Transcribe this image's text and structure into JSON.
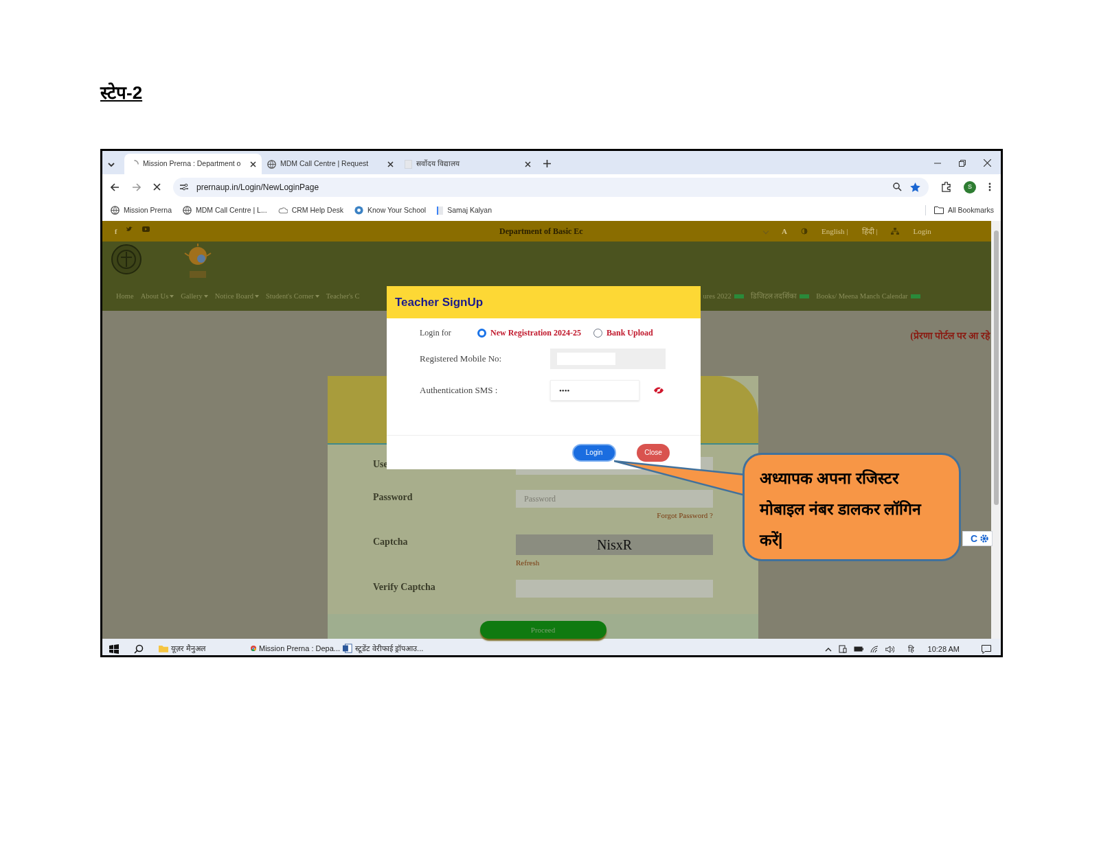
{
  "heading": "स्टेप-2",
  "browser": {
    "tabs": [
      {
        "title": "Mission Prerna : Department o",
        "selected": true,
        "kind": "loading"
      },
      {
        "title": "MDM Call Centre | Request",
        "selected": false,
        "kind": "globe"
      },
      {
        "title": "सर्वोदय विद्यालय",
        "selected": false,
        "kind": "blank"
      }
    ],
    "url": "prernaup.in/Login/NewLoginPage",
    "profile": "S",
    "bookmarks": [
      {
        "label": "Mission Prerna",
        "kind": "globe"
      },
      {
        "label": "MDM Call Centre | L...",
        "kind": "globe"
      },
      {
        "label": "CRM Help Desk",
        "kind": "cloud"
      },
      {
        "label": "Know Your School",
        "kind": "badge"
      },
      {
        "label": "Samaj Kalyan",
        "kind": "blank"
      }
    ],
    "all_bookmarks": "All Bookmarks"
  },
  "site": {
    "top_bar": {
      "facebook": "f",
      "font_size": "A",
      "title": "Department of Basic Ec",
      "links": [
        "English |",
        "हिंदी |",
        "Login"
      ]
    },
    "nav": [
      {
        "label": "Home",
        "dropdown": false,
        "new": false
      },
      {
        "label": "About Us",
        "dropdown": true,
        "new": false
      },
      {
        "label": "Gallery",
        "dropdown": true,
        "new": false
      },
      {
        "label": "Notice Board",
        "dropdown": true,
        "new": false
      },
      {
        "label": "Student's Corner",
        "dropdown": true,
        "new": false
      },
      {
        "label": "Teacher's C",
        "dropdown": false,
        "new": false
      },
      {
        "label": "ures 2022",
        "dropdown": false,
        "new": true
      },
      {
        "label": "डिजिटल तदर्शिका",
        "dropdown": false,
        "new": true
      },
      {
        "label": "Books/ Meena Manch Calendar",
        "dropdown": false,
        "new": true
      }
    ],
    "notice": "(प्रेरणा पोर्टल पर आ रहे",
    "form": {
      "fields": [
        {
          "label": "Use",
          "kind": "text"
        },
        {
          "label": "Password",
          "kind": "text",
          "placeholder": "Password",
          "link": "Forgot Password ?"
        },
        {
          "label": "Captcha",
          "kind": "captcha",
          "captcha": "NisxR",
          "link": "Refresh"
        },
        {
          "label": "Verify Captcha",
          "kind": "text"
        }
      ],
      "button": "Proceed"
    },
    "widget": "C"
  },
  "modal": {
    "title": "Teacher SignUp",
    "login_for": "Login for",
    "options": [
      {
        "label": "New Registration 2024-25",
        "selected": true
      },
      {
        "label": "Bank Upload",
        "selected": false
      }
    ],
    "fields": [
      {
        "label": "Registered Mobile No:",
        "kind": "text"
      },
      {
        "label": "Authentication SMS :",
        "kind": "password",
        "value": "••••"
      }
    ],
    "buttons": [
      {
        "label": "Login",
        "kind": "primary"
      },
      {
        "label": "Close",
        "kind": "danger"
      }
    ]
  },
  "callout": "अध्यापक अपना रजिस्टर मोबाइल नंबर डालकर  लॉगिन करें|",
  "taskbar": {
    "items": [
      {
        "label": "यूज़र मैनुअल",
        "kind": "folder"
      },
      {
        "label": "Mission Prerna : Depa...",
        "kind": "chrome"
      },
      {
        "label": "स्टूडेंट वेरीफाई ड्रॉपआउ...",
        "kind": "word"
      }
    ],
    "language": "हि",
    "time": "10:28 AM"
  }
}
